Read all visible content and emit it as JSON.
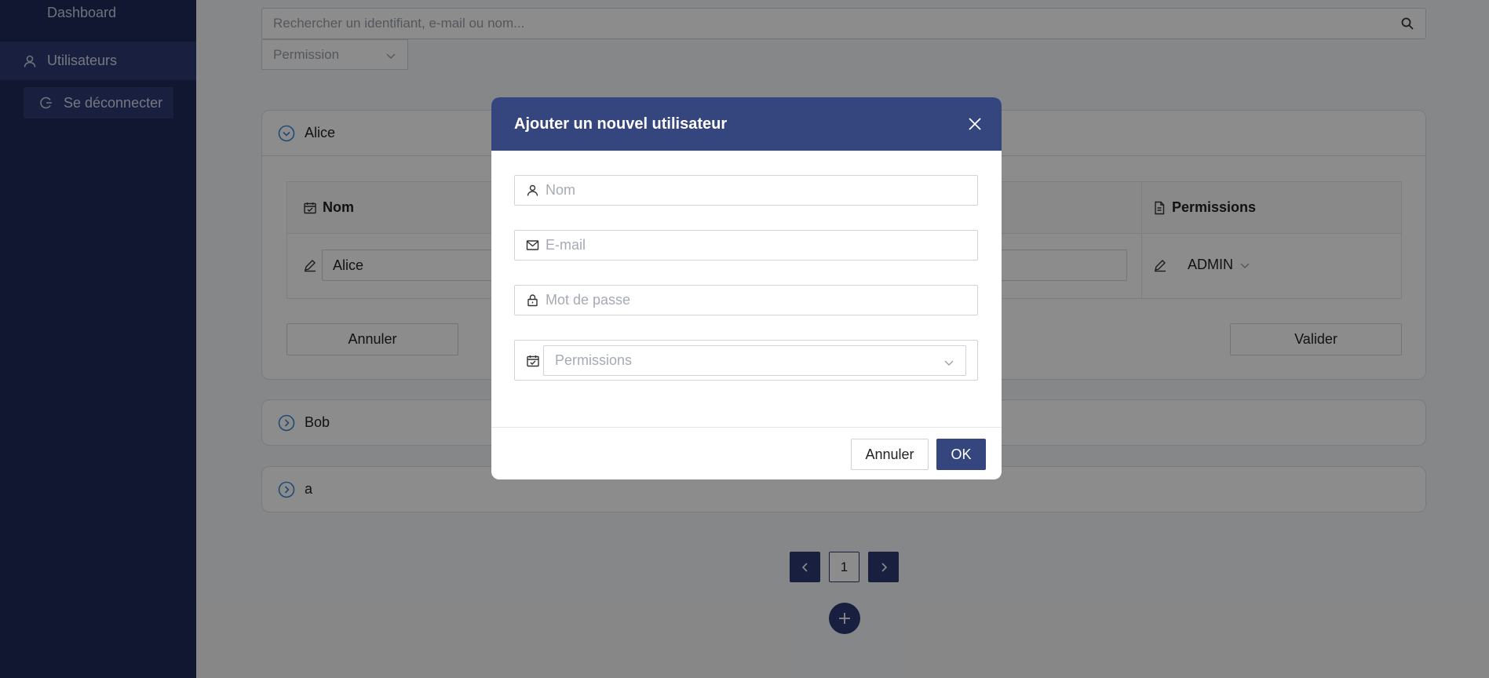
{
  "sidebar": {
    "dashboard_label": "Dashboard",
    "users_label": "Utilisateurs",
    "logout_label": "Se déconnecter"
  },
  "search": {
    "placeholder": "Rechercher un identifiant, e-mail ou nom..."
  },
  "permission_filter": {
    "placeholder": "Permission"
  },
  "users": [
    {
      "name": "Alice",
      "expanded": true,
      "columns": {
        "name_header": "Nom",
        "permissions_header": "Permissions"
      },
      "name_value": "Alice",
      "permission_value": "ADMIN",
      "cancel_label": "Annuler",
      "validate_label": "Valider"
    },
    {
      "name": "Bob",
      "expanded": false
    },
    {
      "name": "a",
      "expanded": false
    }
  ],
  "pagination": {
    "current_page": "1"
  },
  "modal": {
    "title": "Ajouter un nouvel utilisateur",
    "name_placeholder": "Nom",
    "email_placeholder": "E-mail",
    "password_placeholder": "Mot de passe",
    "permissions_placeholder": "Permissions",
    "cancel_label": "Annuler",
    "ok_label": "OK"
  },
  "colors": {
    "sidebar_bg": "#1f2a5a",
    "sidebar_active": "#2c3a73",
    "modal_header": "#35467e",
    "accent_icon": "#3a86d8"
  },
  "icons": {
    "user": "user-icon",
    "logout": "logout-icon",
    "search": "search-icon",
    "mail": "mail-icon",
    "lock": "lock-icon",
    "calendar": "calendar-check-icon",
    "document": "document-icon",
    "edit": "edit-icon",
    "close": "close-icon",
    "plus": "plus-icon"
  }
}
